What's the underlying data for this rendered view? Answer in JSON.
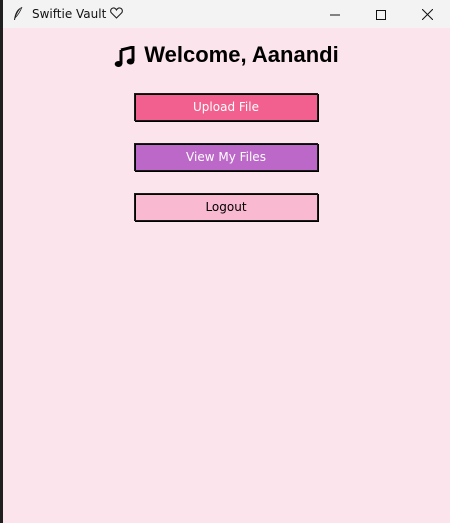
{
  "window": {
    "title": "Swiftie Vault",
    "title_suffix_icon": "heart-icon",
    "app_icon": "feather-icon",
    "controls": [
      "minimize-icon",
      "maximize-icon",
      "close-icon"
    ]
  },
  "main": {
    "welcome_icon": "music-note-icon",
    "welcome_text": "Welcome, Aanandi",
    "buttons": {
      "upload_label": "Upload File",
      "view_label": "View My Files",
      "logout_label": "Logout"
    }
  },
  "colors": {
    "background": "#fbe4ec",
    "upload": "#f2608f",
    "view": "#bb68c8",
    "logout": "#f9b9d0"
  }
}
